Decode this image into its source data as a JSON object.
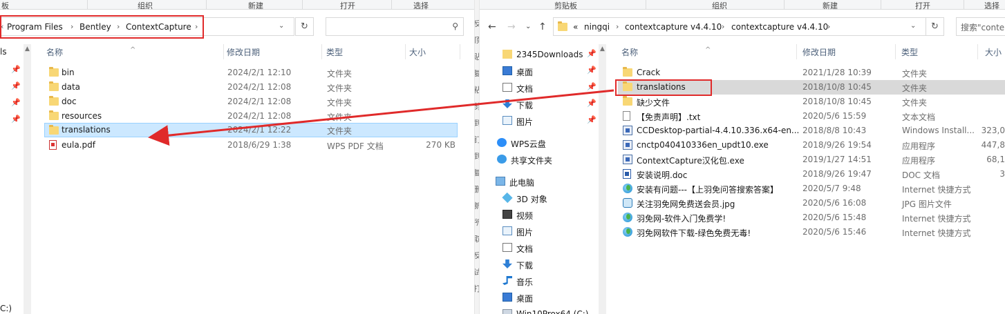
{
  "left": {
    "ribbon": [
      "板",
      "组织",
      "新建",
      "打开",
      "选择"
    ],
    "breadcrumb": [
      "Program Files",
      "Bentley",
      "ContextCapture"
    ],
    "crumb_sep": "›",
    "left_edge_sep": "‹",
    "columns": {
      "name": "名称",
      "date": "修改日期",
      "type": "类型",
      "size": "大小"
    },
    "nav_stub": "ls",
    "nav_stub_bottom": "C:)",
    "files": [
      {
        "name": "bin",
        "date": "2024/2/1 12:10",
        "type": "文件夹",
        "size": "",
        "icon": "folder"
      },
      {
        "name": "data",
        "date": "2024/2/1 12:08",
        "type": "文件夹",
        "size": "",
        "icon": "folder"
      },
      {
        "name": "doc",
        "date": "2024/2/1 12:08",
        "type": "文件夹",
        "size": "",
        "icon": "folder"
      },
      {
        "name": "resources",
        "date": "2024/2/1 12:08",
        "type": "文件夹",
        "size": "",
        "icon": "folder"
      },
      {
        "name": "translations",
        "date": "2024/2/1 12:22",
        "type": "文件夹",
        "size": "",
        "icon": "folder"
      },
      {
        "name": "eula.pdf",
        "date": "2018/6/29 1:38",
        "type": "WPS PDF 文档",
        "size": "270 KB",
        "icon": "pdf"
      }
    ]
  },
  "mid_strip_chars": [
    "反",
    "顶",
    "贴",
    "复",
    "粘",
    "剪",
    "到",
    "钉",
    "到",
    "复",
    "删",
    "新",
    "所",
    "取",
    "反",
    "试",
    "打"
  ],
  "right": {
    "ribbon": [
      "剪贴板",
      "组织",
      "新建",
      "打开",
      "选择"
    ],
    "breadcrumb_overflow": "«",
    "breadcrumb": [
      "ningqi",
      "contextcapture v4.4.10",
      "contextcapture v4.4.10"
    ],
    "crumb_sep": "›",
    "search_placeholder": "搜索\"conte",
    "columns": {
      "name": "名称",
      "date": "修改日期",
      "type": "类型",
      "size": "大小"
    },
    "nav": [
      {
        "label": "2345Downloads",
        "icon": "folder",
        "pinned": true
      },
      {
        "label": "桌面",
        "icon": "desktop",
        "pinned": true
      },
      {
        "label": "文档",
        "icon": "docs",
        "pinned": true
      },
      {
        "label": "下载",
        "icon": "download",
        "pinned": true
      },
      {
        "label": "图片",
        "icon": "pictures",
        "pinned": true
      },
      {
        "label": "WPS云盘",
        "icon": "cloud",
        "pinned": false
      },
      {
        "label": "共享文件夹",
        "icon": "share",
        "pinned": false
      },
      {
        "label": "此电脑",
        "icon": "pc",
        "pinned": false
      },
      {
        "label": "3D 对象",
        "icon": "3d",
        "pinned": false
      },
      {
        "label": "视频",
        "icon": "video",
        "pinned": false
      },
      {
        "label": "图片",
        "icon": "pictures",
        "pinned": false
      },
      {
        "label": "文档",
        "icon": "docs",
        "pinned": false
      },
      {
        "label": "下载",
        "icon": "download",
        "pinned": false
      },
      {
        "label": "音乐",
        "icon": "music",
        "pinned": false
      },
      {
        "label": "桌面",
        "icon": "desktop",
        "pinned": false
      },
      {
        "label": "Win10Prox64 (C:)",
        "icon": "drive",
        "pinned": false
      }
    ],
    "files": [
      {
        "name": "Crack",
        "date": "2021/1/28 10:39",
        "type": "文件夹",
        "size": "",
        "icon": "folder"
      },
      {
        "name": "translations",
        "date": "2018/10/8 10:45",
        "type": "文件夹",
        "size": "",
        "icon": "folder"
      },
      {
        "name": "缺少文件",
        "date": "2018/10/8 10:45",
        "type": "文件夹",
        "size": "",
        "icon": "folder"
      },
      {
        "name": "【免责声明】.txt",
        "date": "2020/5/6 15:59",
        "type": "文本文档",
        "size": "",
        "icon": "txt"
      },
      {
        "name": "CCDesktop-partial-4.4.10.336.x64-en...",
        "date": "2018/8/8 10:43",
        "type": "Windows Install...",
        "size": "323,0",
        "icon": "exe"
      },
      {
        "name": "cnctp040410336en_updt10.exe",
        "date": "2018/9/26 19:54",
        "type": "应用程序",
        "size": "447,8",
        "icon": "exe"
      },
      {
        "name": "ContextCapture汉化包.exe",
        "date": "2019/1/27 14:51",
        "type": "应用程序",
        "size": "68,1",
        "icon": "exe"
      },
      {
        "name": "安装说明.doc",
        "date": "2018/9/26 19:47",
        "type": "DOC 文档",
        "size": "3",
        "icon": "doc"
      },
      {
        "name": "安装有问题---【上羽免问答搜索答案】",
        "date": "2020/5/7 9:48",
        "type": "Internet 快捷方式",
        "size": "",
        "icon": "url"
      },
      {
        "name": "关注羽免网免费送会员.jpg",
        "date": "2020/5/6 16:08",
        "type": "JPG 图片文件",
        "size": "",
        "icon": "jpg"
      },
      {
        "name": "羽免网-软件入门免费学!",
        "date": "2020/5/6 15:48",
        "type": "Internet 快捷方式",
        "size": "",
        "icon": "url"
      },
      {
        "name": "羽免网软件下载-绿色免费无毒!",
        "date": "2020/5/6 15:46",
        "type": "Internet 快捷方式",
        "size": "",
        "icon": "url"
      }
    ]
  },
  "annotation": {
    "color": "#e02a2a",
    "from": "right translations",
    "to": "left translations"
  }
}
